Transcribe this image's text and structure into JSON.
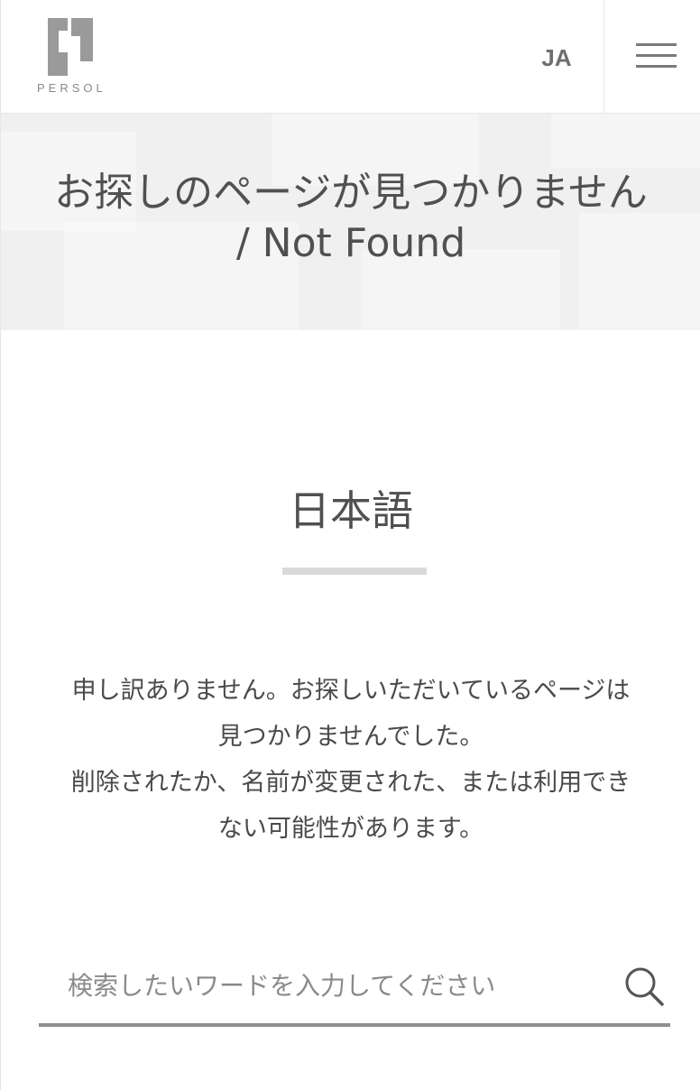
{
  "header": {
    "logo_text": "PERSOL",
    "language": "JA",
    "menu_icon": "hamburger-menu-icon"
  },
  "hero": {
    "title_line1": "お探しのページが見つかりません",
    "title_line2": "/ Not Found"
  },
  "section": {
    "title": "日本語"
  },
  "message": {
    "line1": "申し訳ありません。お探しいただいているページは",
    "line2": "見つかりませんでした。",
    "line3": "削除されたか、名前が変更された、または利用でき",
    "line4": "ない可能性があります。"
  },
  "search": {
    "placeholder": "検索したいワードを入力してください",
    "icon": "search-icon"
  },
  "colors": {
    "text": "#4a4a4a",
    "hero_bg": "#f0f0f0",
    "underline": "#d9d9d9",
    "search_border": "#8f8f8f",
    "logo": "#9a9a9a"
  }
}
